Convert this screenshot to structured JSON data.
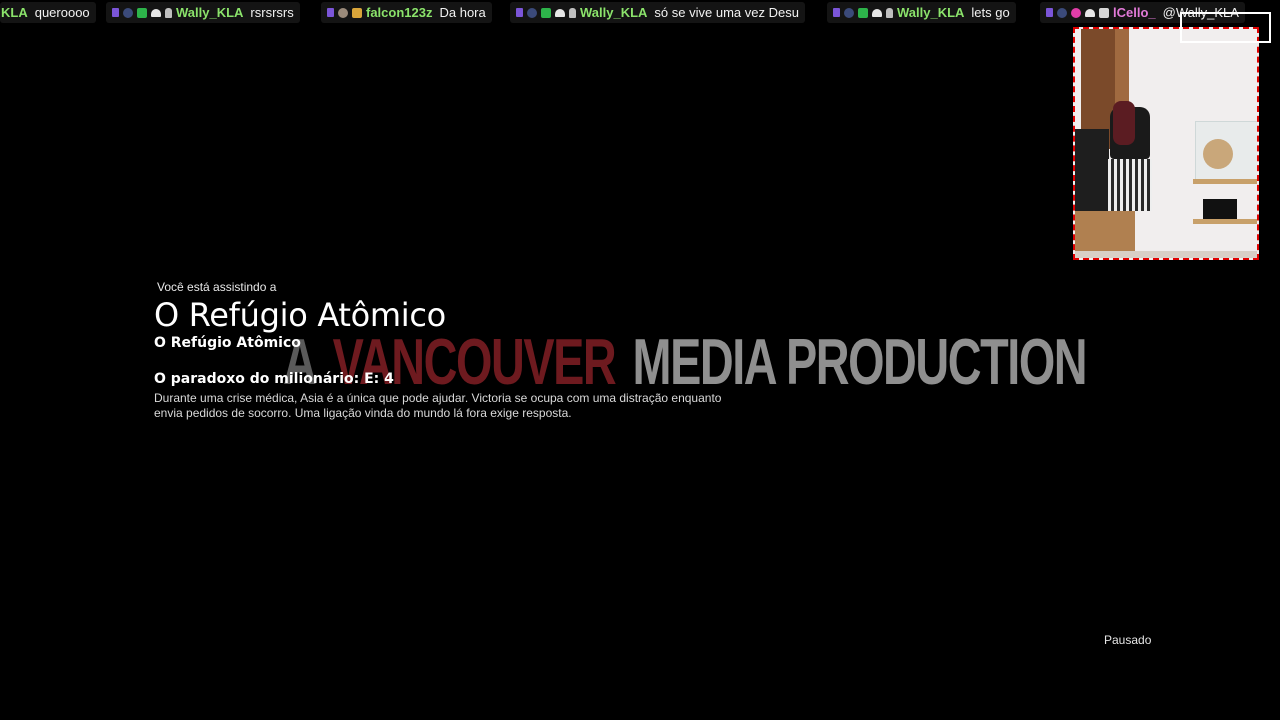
{
  "chat": [
    {
      "user": "KLA",
      "user_color": "#8be36b",
      "text": "queroooo",
      "badges": []
    },
    {
      "user": "Wally_KLA",
      "user_color": "#8be36b",
      "text": "rsrsrsrs",
      "badges": [
        "platform-icon",
        "sub-badge-icon",
        "check-badge-icon",
        "hat-badge-icon",
        "bunny-badge-icon"
      ]
    },
    {
      "user": "falcon123z",
      "user_color": "#8be36b",
      "text": "Da hora",
      "badges": [
        "platform-icon",
        "face-badge-icon",
        "gift-badge-icon"
      ]
    },
    {
      "user": "Wally_KLA",
      "user_color": "#8be36b",
      "text": "só se vive uma vez Desu",
      "badges": [
        "platform-icon",
        "sub-badge-icon",
        "check-badge-icon",
        "hat-badge-icon",
        "bunny-badge-icon"
      ]
    },
    {
      "user": "Wally_KLA",
      "user_color": "#8be36b",
      "text": "lets go",
      "badges": [
        "platform-icon",
        "sub-badge-icon",
        "check-badge-icon",
        "hat-badge-icon",
        "bunny-badge-icon"
      ]
    },
    {
      "user": "lCello_",
      "user_color": "#e27ad8",
      "text": "@Wally_KLA",
      "badges": [
        "platform-icon",
        "sub-badge-icon",
        "heart-badge-icon",
        "hat-badge-icon",
        "gem-badge-icon"
      ]
    }
  ],
  "watermark": {
    "word1": "A",
    "word2": "VANCOUVER",
    "word3": "MEDIA PRODUCTION"
  },
  "info": {
    "kicker": "Você está assistindo a",
    "title": "O Refúgio Atômico",
    "subtitle": "O Refúgio Atômico",
    "episode": "O paradoxo do milionário: E: 4",
    "description": "Durante uma crise médica, Asia é a única que pode ajudar. Victoria se ocupa com uma distração enquanto envia pedidos de socorro. Uma ligação vinda do mundo lá fora exige resposta."
  },
  "status": "Pausado",
  "colors": {
    "background": "#000000",
    "webcam_border": "#e00000",
    "chat_user": "#8be36b"
  }
}
